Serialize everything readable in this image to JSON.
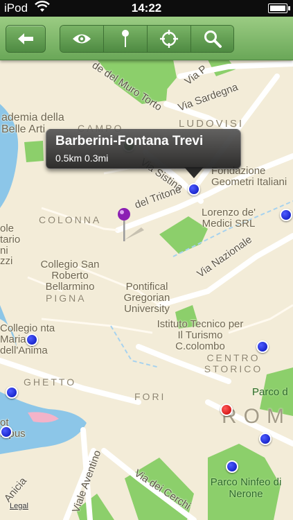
{
  "status_bar": {
    "carrier": "iPod",
    "time": "14:22"
  },
  "toolbar": {
    "back_icon": "arrow-left-icon",
    "view_icon": "eye-icon",
    "pin_icon": "pin-icon",
    "locate_icon": "crosshair-icon",
    "search_icon": "magnifier-icon"
  },
  "callout": {
    "title": "Barberini-Fontana Trevi",
    "subtitle": "0.5km 0.3mi"
  },
  "map": {
    "streets": [
      "Via Sardegna",
      "Via Sistina",
      "del Tritone",
      "Via Nazionale",
      "de del Muro Torto",
      "Via dei Cerchi",
      "Viale Aventino",
      "Anicia",
      "Via P"
    ],
    "districts": [
      "LUDOVISI",
      "CAMPO",
      "COLONNA",
      "PIGNA",
      "GHETTO",
      "FORI",
      "CENTRO STORICO",
      "ROM"
    ],
    "places": [
      "ademia della Belle Arti",
      "Fondazione Geometri Italiani",
      "Lorenzo de' Medici SRL",
      "Collegio San Roberto Bellarmino",
      "Pontifical Gregorian University",
      "Istituto Tecnico per Il Turismo C.colombo",
      "Collegio nta Maria dell'Anima",
      "Parco Ninfeo di Nerone",
      "Parco d",
      "ole tario ni zzi",
      "ot mpus"
    ],
    "legal": "Legal"
  },
  "colors": {
    "toolbar": "#7ab466",
    "park": "#8ccf6b",
    "road": "#ffffff",
    "water": "#8cc6e8",
    "pin_blue": "#0511b8",
    "pin_red": "#d40000",
    "pin_purple": "#8b1fb3"
  }
}
